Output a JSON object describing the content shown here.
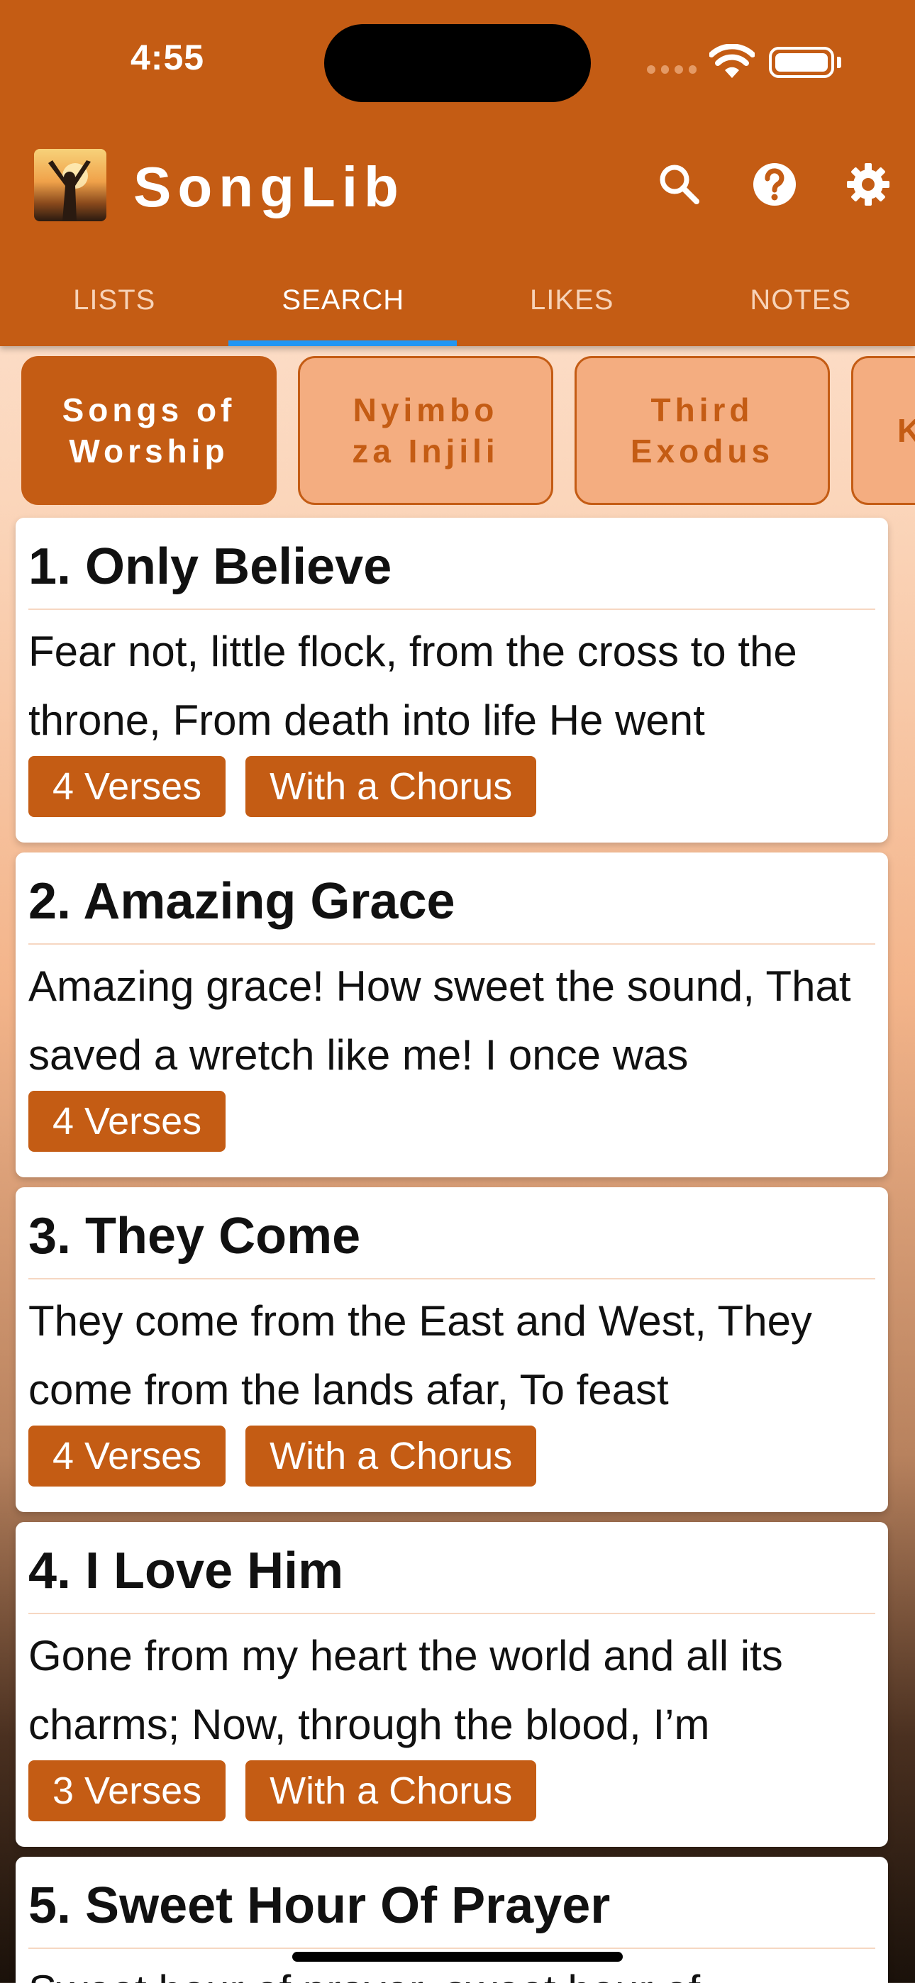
{
  "status_bar": {
    "time": "4:55"
  },
  "header": {
    "title": "SongLib"
  },
  "tabs": [
    {
      "label": "LISTS"
    },
    {
      "label": "SEARCH"
    },
    {
      "label": "LIKES"
    },
    {
      "label": "NOTES"
    }
  ],
  "active_tab": "SEARCH",
  "books": [
    {
      "label": "Songs of\nWorship",
      "selected": true
    },
    {
      "label": "Nyimbo\nza Injili",
      "selected": false
    },
    {
      "label": "Third\nExodus",
      "selected": false
    },
    {
      "label": "K",
      "selected": false
    }
  ],
  "songs": [
    {
      "title": "1. Only Believe",
      "snippet": "Fear not, little flock, from the cross to the throne, From death into life He went",
      "tags": [
        "4 Verses",
        "With a Chorus"
      ]
    },
    {
      "title": "2. Amazing Grace",
      "snippet": "Amazing grace! How sweet the sound, That saved a wretch like me! I once was",
      "tags": [
        "4 Verses"
      ]
    },
    {
      "title": "3. They Come",
      "snippet": "They come from the East and West, They come from the lands afar, To feast",
      "tags": [
        "4 Verses",
        "With a Chorus"
      ]
    },
    {
      "title": "4. I Love Him",
      "snippet": "Gone from my heart the world and all its charms; Now, through the blood, I’m",
      "tags": [
        "3 Verses",
        "With a Chorus"
      ]
    },
    {
      "title": "5. Sweet Hour Of Prayer",
      "snippet": "Sweet hour of prayer, sweet hour of",
      "tags": []
    }
  ],
  "icons": {
    "search": "search-icon",
    "help": "help-icon",
    "settings": "gear-icon"
  },
  "colors": {
    "primary": "#c45c14",
    "chip_bg": "#f4ad80",
    "tab_indicator": "#2196f3"
  }
}
